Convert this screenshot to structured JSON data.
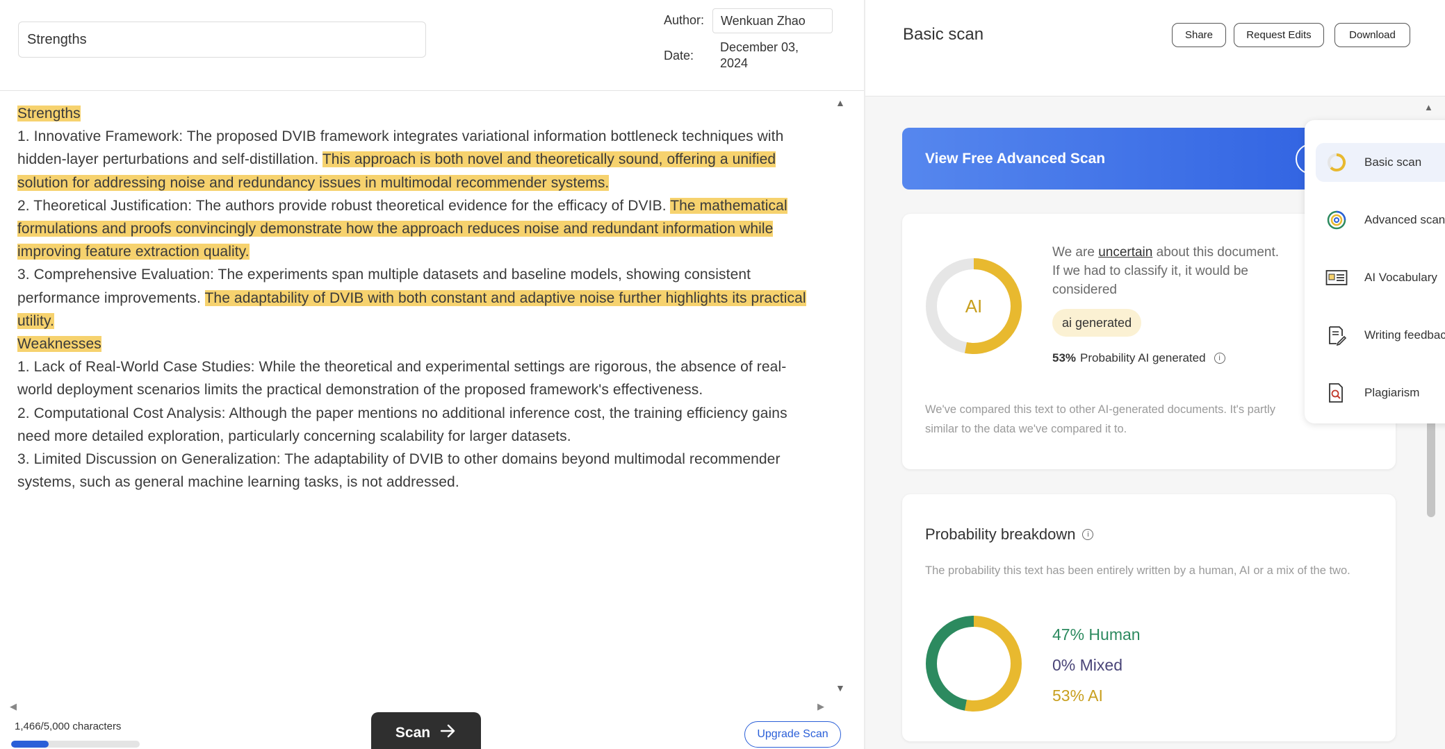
{
  "editor": {
    "title_value": "Strengths",
    "author_label": "Author:",
    "author_value": "Wenkuan Zhao",
    "date_label": "Date:",
    "date_line1": "December 03,",
    "date_line2": "2024",
    "paragraphs": [
      [
        {
          "t": "Strengths",
          "h": true
        }
      ],
      [
        {
          "t": "1. Innovative Framework: The proposed DVIB framework integrates variational information bottleneck techniques with hidden-layer perturbations and self-distillation. ",
          "h": false
        },
        {
          "t": "This approach is both novel and theoretically sound, offering a unified solution for addressing noise and redundancy issues in multimodal recommender systems.",
          "h": true
        }
      ],
      [
        {
          "t": "2. Theoretical Justification: The authors provide robust theoretical evidence for the efficacy of DVIB. ",
          "h": false
        },
        {
          "t": "The mathematical formulations and proofs convincingly demonstrate how the approach reduces noise and redundant information while improving feature extraction quality.",
          "h": true
        }
      ],
      [
        {
          "t": "3. Comprehensive Evaluation: The experiments span multiple datasets and baseline models, showing consistent performance improvements. ",
          "h": false
        },
        {
          "t": "The adaptability of DVIB with both constant and adaptive noise further highlights its practical utility.",
          "h": true
        }
      ],
      [
        {
          "t": "Weaknesses",
          "h": true
        }
      ],
      [
        {
          "t": "1. Lack of Real-World Case Studies: While the theoretical and experimental settings are rigorous, the absence of real-world deployment scenarios limits the practical demonstration of the proposed framework's effectiveness.",
          "h": false
        }
      ],
      [
        {
          "t": "2. Computational Cost Analysis: Although the paper mentions no additional inference cost, the training efficiency gains need more detailed exploration, particularly concerning scalability for larger datasets.",
          "h": false
        }
      ],
      [
        {
          "t": "3. Limited Discussion on Generalization: The adaptability of DVIB to other domains beyond multimodal recommender systems, such as general machine learning tasks, is not addressed.",
          "h": false
        }
      ]
    ],
    "char_count": "1,466/5,000 characters",
    "char_fraction": 0.2932,
    "scan_label": "Scan",
    "upgrade_label": "Upgrade Scan"
  },
  "results": {
    "title": "Basic scan",
    "share_label": "Share",
    "request_edits_label": "Request Edits",
    "download_label": "Download",
    "banner_label": "View Free Advanced Scan",
    "donut_label": "AI",
    "verdict_pre": "We are ",
    "verdict_word": "uncertain",
    "verdict_post": " about this document. If we had to classify it, it would be considered",
    "badge": "ai generated",
    "probability_pct": "53%",
    "probability_label": "Probability AI generated",
    "compare_note": "We've compared this text to other AI-generated documents. It's partly similar to the data we've compared it to.",
    "breakdown_title": "Probability breakdown",
    "breakdown_desc": "The probability this text has been entirely written by a human, AI or a mix of the two.",
    "human_label": "47% Human",
    "mixed_label": "0% Mixed",
    "ai_label": "53% AI",
    "human_fraction": 0.47,
    "mixed_fraction": 0.0,
    "ai_fraction": 0.53
  },
  "menu": {
    "items": [
      {
        "label": "Basic scan",
        "icon": "basic-scan-icon"
      },
      {
        "label": "Advanced scan",
        "icon": "advanced-scan-icon"
      },
      {
        "label": "AI Vocabulary",
        "icon": "ai-vocabulary-icon"
      },
      {
        "label": "Writing feedback",
        "icon": "writing-feedback-icon"
      },
      {
        "label": "Plagiarism",
        "icon": "plagiarism-icon"
      }
    ]
  },
  "colors": {
    "highlight": "#f6d26e",
    "accent_blue": "#2a5fd8",
    "ai_yellow": "#e8b92f",
    "human_green": "#2c8a5f",
    "donut_track": "#e6e6e6"
  }
}
